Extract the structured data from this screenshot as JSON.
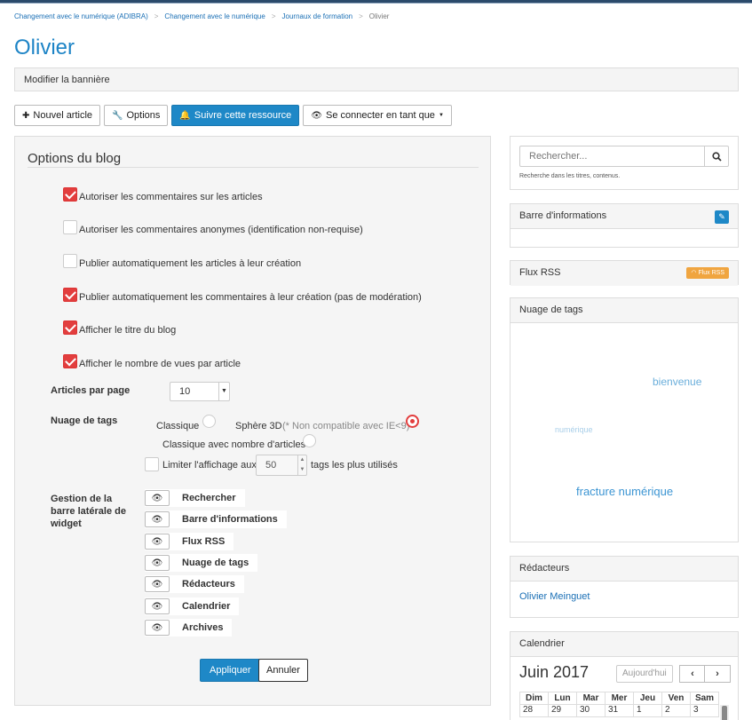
{
  "breadcrumb": {
    "items": [
      "Changement avec le numérique (ADIBRA)",
      "Changement avec le numérique",
      "Journaux de formation"
    ],
    "current": "Olivier"
  },
  "page": {
    "title": "Olivier"
  },
  "banner": {
    "label": "Modifier la bannière"
  },
  "toolbar": {
    "new_article": "Nouvel article",
    "options": "Options",
    "follow": "Suivre cette ressource",
    "connect_as": "Se connecter en tant que"
  },
  "blog_options": {
    "title": "Options du blog",
    "checkboxes": [
      {
        "label": "Autoriser les commentaires sur les articles",
        "checked": true
      },
      {
        "label": "Autoriser les commentaires anonymes (identification non-requise)",
        "checked": false
      },
      {
        "label": "Publier automatiquement les articles à leur création",
        "checked": false
      },
      {
        "label": "Publier automatiquement les commentaires à leur création (pas de modération)",
        "checked": true
      },
      {
        "label": "Afficher le titre du blog",
        "checked": true
      },
      {
        "label": "Afficher le nombre de vues par article",
        "checked": true
      }
    ],
    "articles_per_page": {
      "label": "Articles par page",
      "value": "10"
    },
    "tag_cloud": {
      "label": "Nuage de tags",
      "options": {
        "classic": "Classique",
        "sphere": "Sphère 3D",
        "sphere_note": "(* Non compatible avec IE<9)",
        "classic_count": "Classique avec nombre d'articles"
      },
      "selected": "sphere",
      "limit_label": "Limiter l'affichage aux",
      "limit_value": "50",
      "limit_suffix": "tags les plus utilisés",
      "limit_checked": false
    },
    "widgets": {
      "label": "Gestion de la barre latérale de widget",
      "items": [
        "Rechercher",
        "Barre d'informations",
        "Flux RSS",
        "Nuage de tags",
        "Rédacteurs",
        "Calendrier",
        "Archives"
      ]
    },
    "apply": "Appliquer",
    "cancel": "Annuler"
  },
  "sidebar": {
    "search": {
      "placeholder": "Rechercher...",
      "help": "Recherche dans les titres, contenus."
    },
    "info_bar": {
      "title": "Barre d'informations"
    },
    "rss": {
      "title": "Flux RSS",
      "badge": "Flux RSS"
    },
    "tags": {
      "title": "Nuage de tags",
      "items": [
        "bienvenue",
        "numérique",
        "fracture numérique"
      ]
    },
    "editors": {
      "title": "Rédacteurs",
      "names": [
        "Olivier Meinguet"
      ]
    },
    "calendar": {
      "title": "Calendrier",
      "month": "Juin 2017",
      "today": "Aujourd'hui",
      "prev": "‹",
      "next": "›",
      "days": [
        "Dim",
        "Lun",
        "Mar",
        "Mer",
        "Jeu",
        "Ven",
        "Sam"
      ],
      "first_row": [
        "28",
        "29",
        "30",
        "31",
        "1",
        "2",
        "3"
      ]
    }
  },
  "colors": {
    "accent": "#1e88c7",
    "checkbox": "#e23e3e",
    "title": "#1d84c6",
    "rss": "#f0a540"
  }
}
